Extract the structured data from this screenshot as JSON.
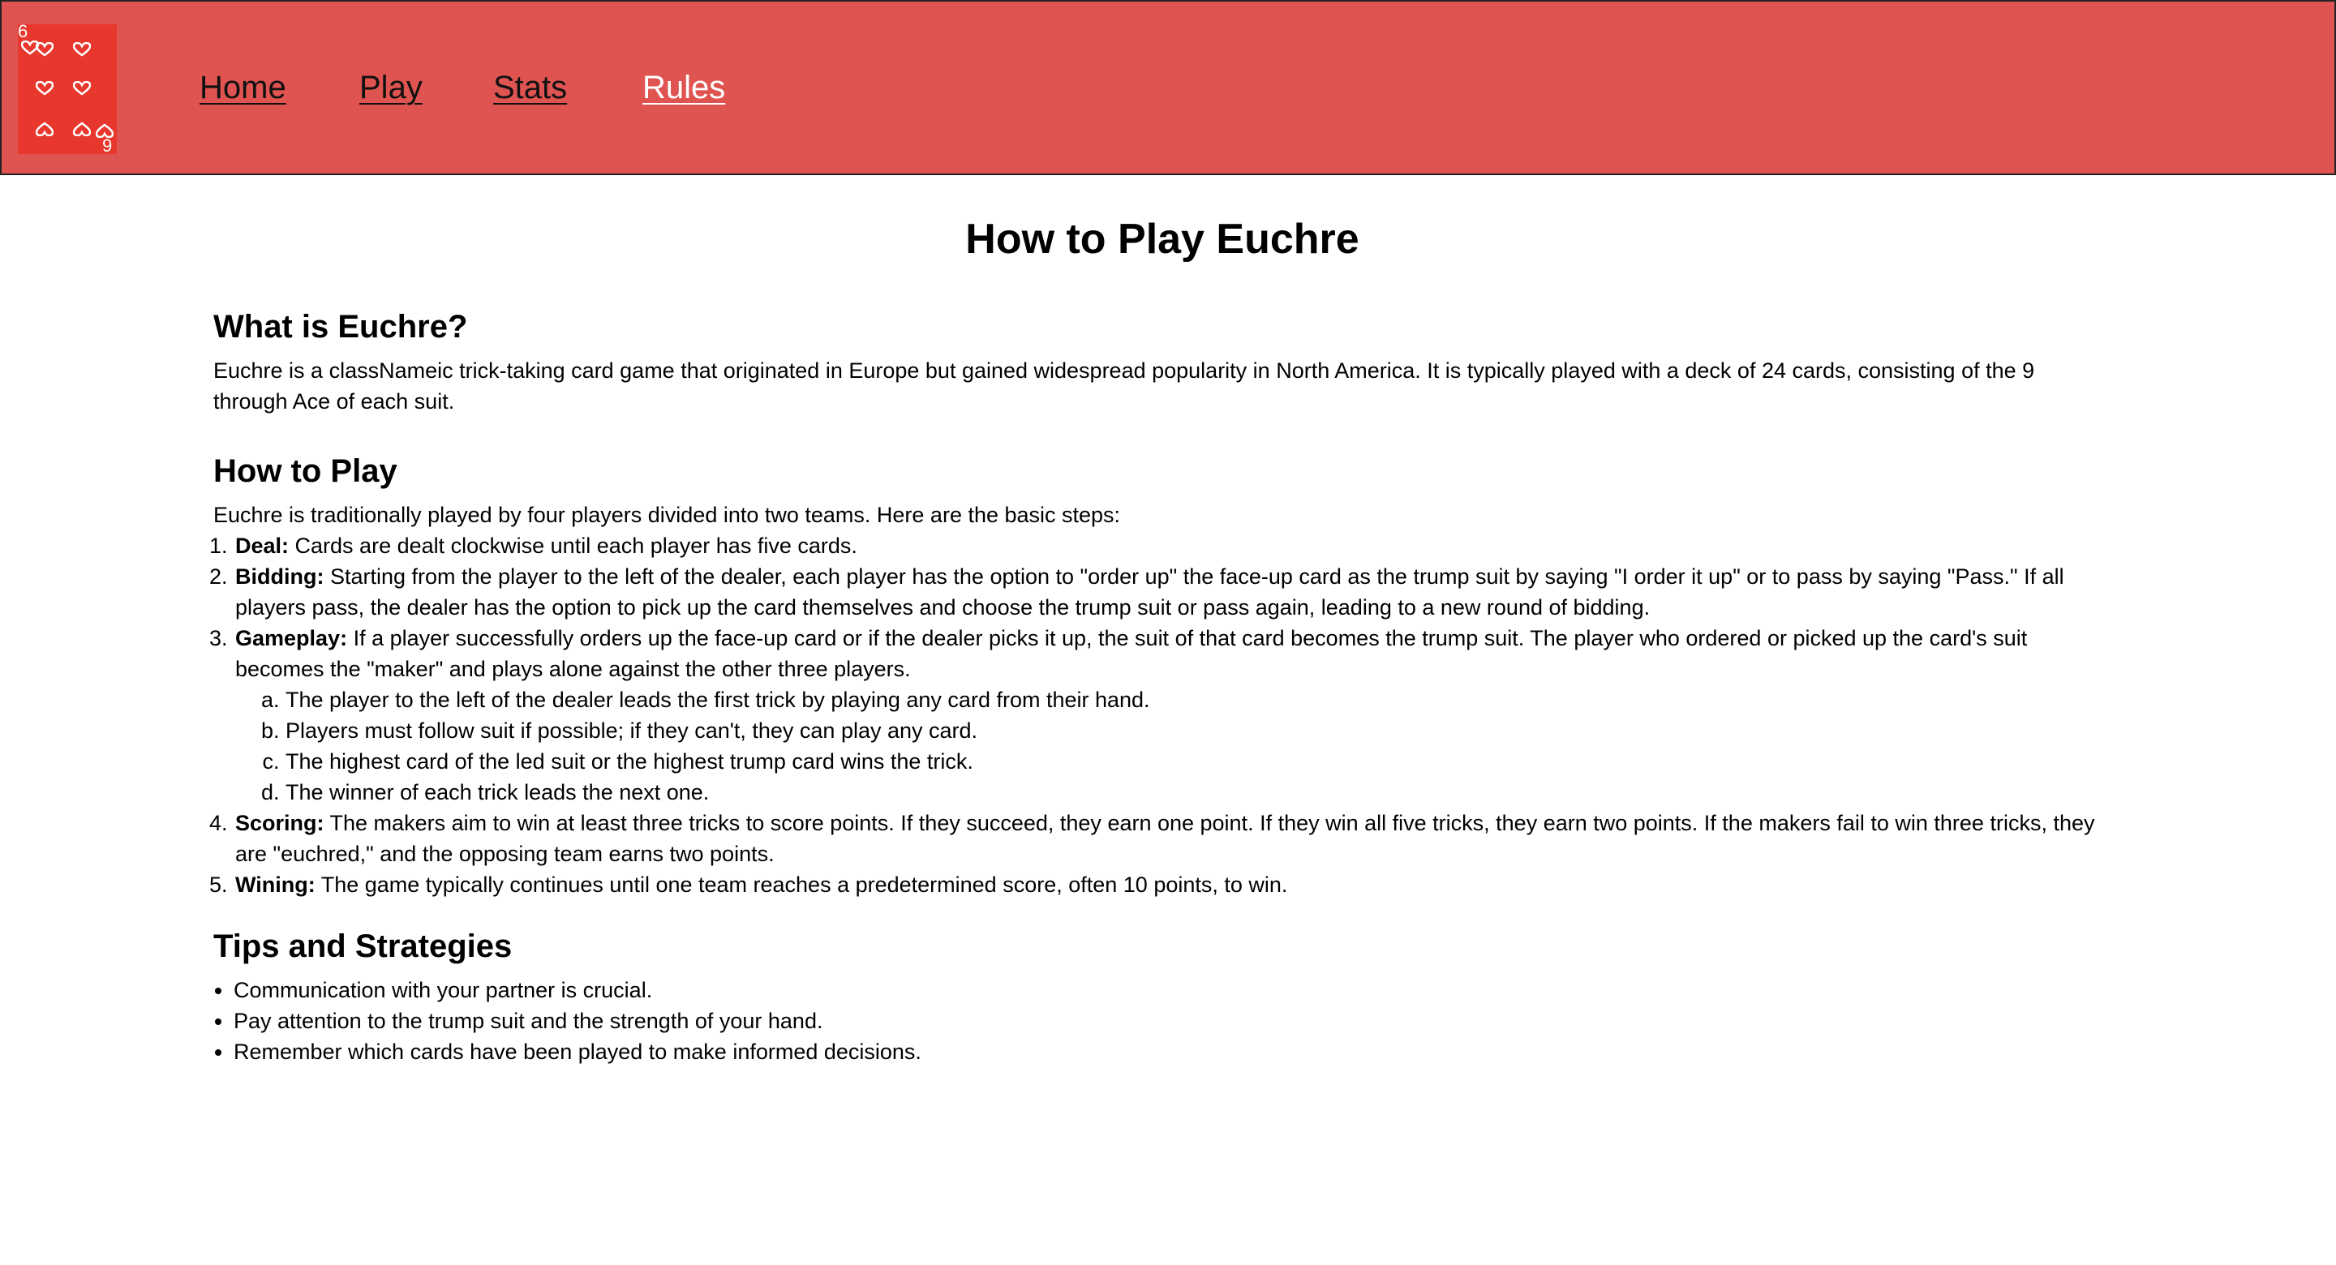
{
  "nav": {
    "logo": {
      "corner_top": "6",
      "corner_bottom": "9",
      "pip_color": "#ffffff",
      "bg_color": "#e8372c",
      "icon": "hearts-card-icon"
    },
    "links": [
      {
        "label": "Home",
        "active": false
      },
      {
        "label": "Play",
        "active": false
      },
      {
        "label": "Stats",
        "active": false
      },
      {
        "label": "Rules",
        "active": true
      }
    ],
    "bg_color": "#df5450"
  },
  "page": {
    "title": "How to Play Euchre",
    "sections": {
      "what": {
        "heading": "What is Euchre?",
        "body": "Euchre is a classNameic trick-taking card game that originated in Europe but gained widespread popularity in North America. It is typically played with a deck of 24 cards, consisting of the 9 through Ace of each suit."
      },
      "how": {
        "heading": "How to Play",
        "intro": "Euchre is traditionally played by four players divided into two teams. Here are the basic steps:",
        "steps": [
          {
            "term": "Deal:",
            "text": " Cards are dealt clockwise until each player has five cards."
          },
          {
            "term": "Bidding:",
            "text": " Starting from the player to the left of the dealer, each player has the option to \"order up\" the face-up card as the trump suit by saying \"I order it up\" or to pass by saying \"Pass.\" If all players pass, the dealer has the option to pick up the card themselves and choose the trump suit or pass again, leading to a new round of bidding."
          },
          {
            "term": "Gameplay:",
            "text": " If a player successfully orders up the face-up card or if the dealer picks it up, the suit of that card becomes the trump suit. The player who ordered or picked up the card's suit becomes the \"maker\" and plays alone against the other three players."
          },
          {
            "term": "Scoring:",
            "text": " The makers aim to win at least three tricks to score points. If they succeed, they earn one point. If they win all five tricks, they earn two points. If the makers fail to win three tricks, they are \"euchred,\" and the opposing team earns two points."
          },
          {
            "term": "Wining:",
            "text": " The game typically continues until one team reaches a predetermined score, often 10 points, to win."
          }
        ],
        "gameplay_substeps": [
          "The player to the left of the dealer leads the first trick by playing any card from their hand.",
          "Players must follow suit if possible; if they can't, they can play any card.",
          "The highest card of the led suit or the highest trump card wins the trick.",
          "The winner of each trick leads the next one."
        ]
      },
      "tips": {
        "heading": "Tips and Strategies",
        "items": [
          "Communication with your partner is crucial.",
          "Pay attention to the trump suit and the strength of your hand.",
          "Remember which cards have been played to make informed decisions."
        ]
      }
    }
  }
}
